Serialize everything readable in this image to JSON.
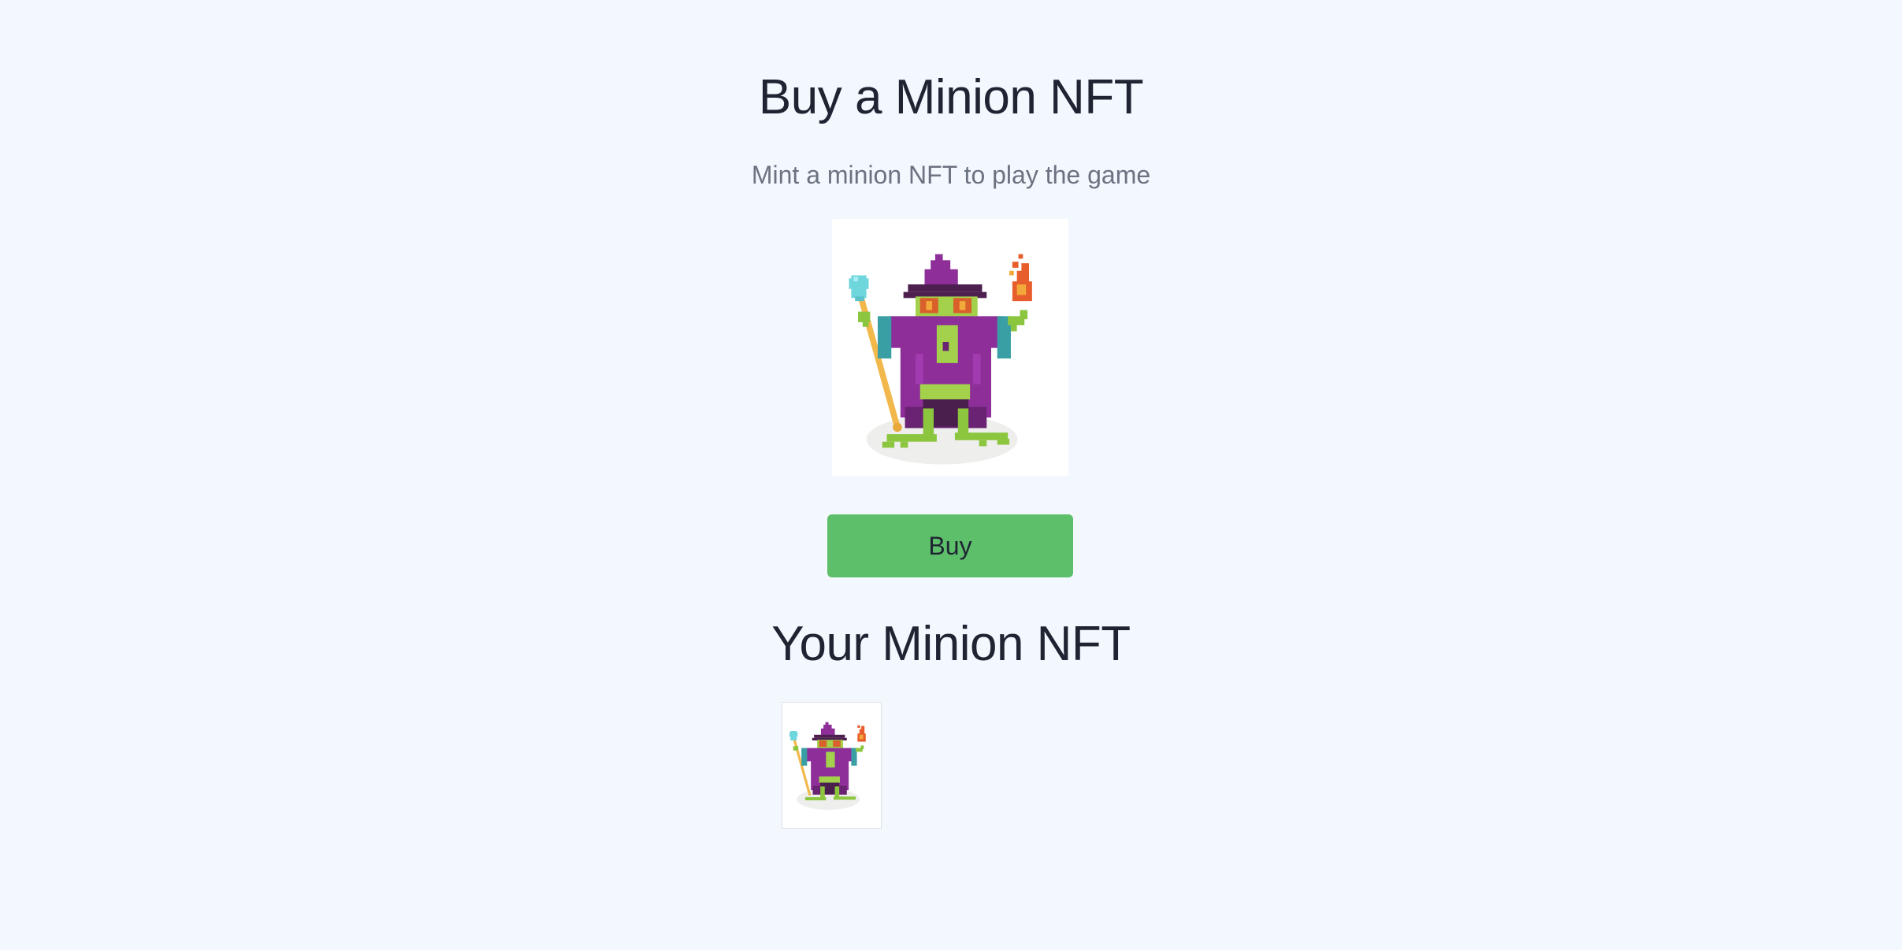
{
  "page": {
    "title": "Buy a Minion NFT",
    "subtitle": "Mint a minion NFT to play the game"
  },
  "mint": {
    "preview_icon": "frog-wizard-nft-image",
    "buy_label": "Buy",
    "button_color": "#5dbf69"
  },
  "owned": {
    "heading": "Your Minion NFT",
    "items": [
      {
        "icon": "frog-wizard-nft-image"
      }
    ]
  },
  "colors": {
    "background": "#f3f7fe",
    "text_primary": "#1f2433",
    "text_secondary": "#6b7280"
  }
}
